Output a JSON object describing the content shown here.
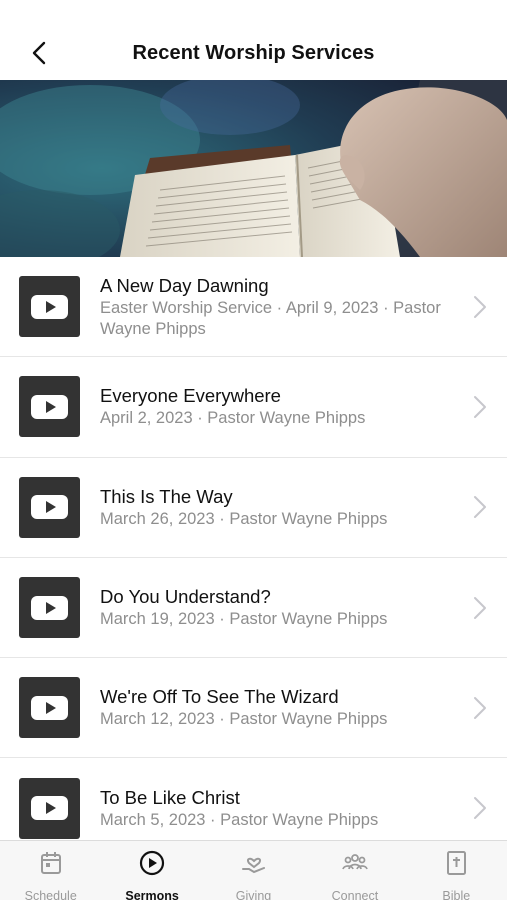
{
  "header": {
    "title": "Recent Worship Services",
    "back_icon": "chevron-left-icon"
  },
  "sermons": [
    {
      "title": "A New Day Dawning",
      "subtitle": "Easter Worship Service · April 9, 2023 · Pastor Wayne Phipps"
    },
    {
      "title": "Everyone Everywhere",
      "subtitle": "April 2, 2023 · Pastor Wayne Phipps"
    },
    {
      "title": "This Is The Way",
      "subtitle": "March 26, 2023 · Pastor Wayne Phipps"
    },
    {
      "title": "Do You Understand?",
      "subtitle": "March 19, 2023 · Pastor Wayne Phipps"
    },
    {
      "title": "We're Off To See The Wizard",
      "subtitle": "March 12, 2023 · Pastor Wayne Phipps"
    },
    {
      "title": "To Be Like Christ",
      "subtitle": "March 5, 2023 · Pastor Wayne Phipps"
    }
  ],
  "tabs": [
    {
      "label": "Schedule",
      "icon": "calendar-icon",
      "active": false
    },
    {
      "label": "Sermons",
      "icon": "play-circle-icon",
      "active": true
    },
    {
      "label": "Giving",
      "icon": "giving-hand-icon",
      "active": false
    },
    {
      "label": "Connect",
      "icon": "people-group-icon",
      "active": false
    },
    {
      "label": "Bible",
      "icon": "bible-icon",
      "active": false
    }
  ],
  "colors": {
    "thumb_bg": "#333333",
    "subtitle": "#8e8e8e",
    "tab_inactive": "#9a9a9a",
    "tab_active": "#111111"
  }
}
